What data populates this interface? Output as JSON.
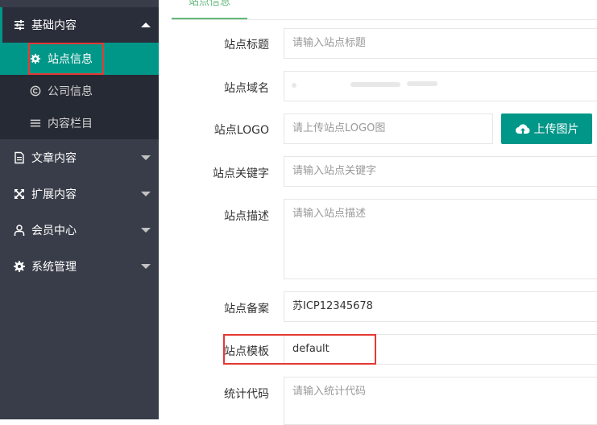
{
  "sidebar": {
    "groups": [
      {
        "label": "基础内容",
        "icon": "sliders-icon",
        "expanded": true
      },
      {
        "label": "文章内容",
        "icon": "document-icon"
      },
      {
        "label": "扩展内容",
        "icon": "expand-icon"
      },
      {
        "label": "会员中心",
        "icon": "user-icon"
      },
      {
        "label": "系统管理",
        "icon": "gear-icon"
      }
    ],
    "sub_items": [
      {
        "label": "站点信息",
        "icon": "gear-icon",
        "active": true
      },
      {
        "label": "公司信息",
        "icon": "copyright-icon"
      },
      {
        "label": "内容栏目",
        "icon": "menu-icon"
      }
    ]
  },
  "tab": {
    "active_label": "站点信息"
  },
  "form": {
    "title": {
      "label": "站点标题",
      "placeholder": "请输入站点标题"
    },
    "domain": {
      "label": "站点域名",
      "value": ""
    },
    "logo": {
      "label": "站点LOGO",
      "placeholder": "请上传站点LOGO图",
      "button_label": "上传图片"
    },
    "keywords": {
      "label": "站点关键字",
      "placeholder": "请输入站点关键字"
    },
    "description": {
      "label": "站点描述",
      "placeholder": "请输入站点描述"
    },
    "icp": {
      "label": "站点备案",
      "value": "苏ICP12345678"
    },
    "template": {
      "label": "站点模板",
      "value": "default"
    },
    "stats": {
      "label": "统计代码",
      "placeholder": "请输入统计代码"
    }
  },
  "colors": {
    "sidebar_bg": "#393d49",
    "sidebar_sub_bg": "#262a34",
    "accent": "#009688",
    "highlight_box": "#e53935"
  }
}
